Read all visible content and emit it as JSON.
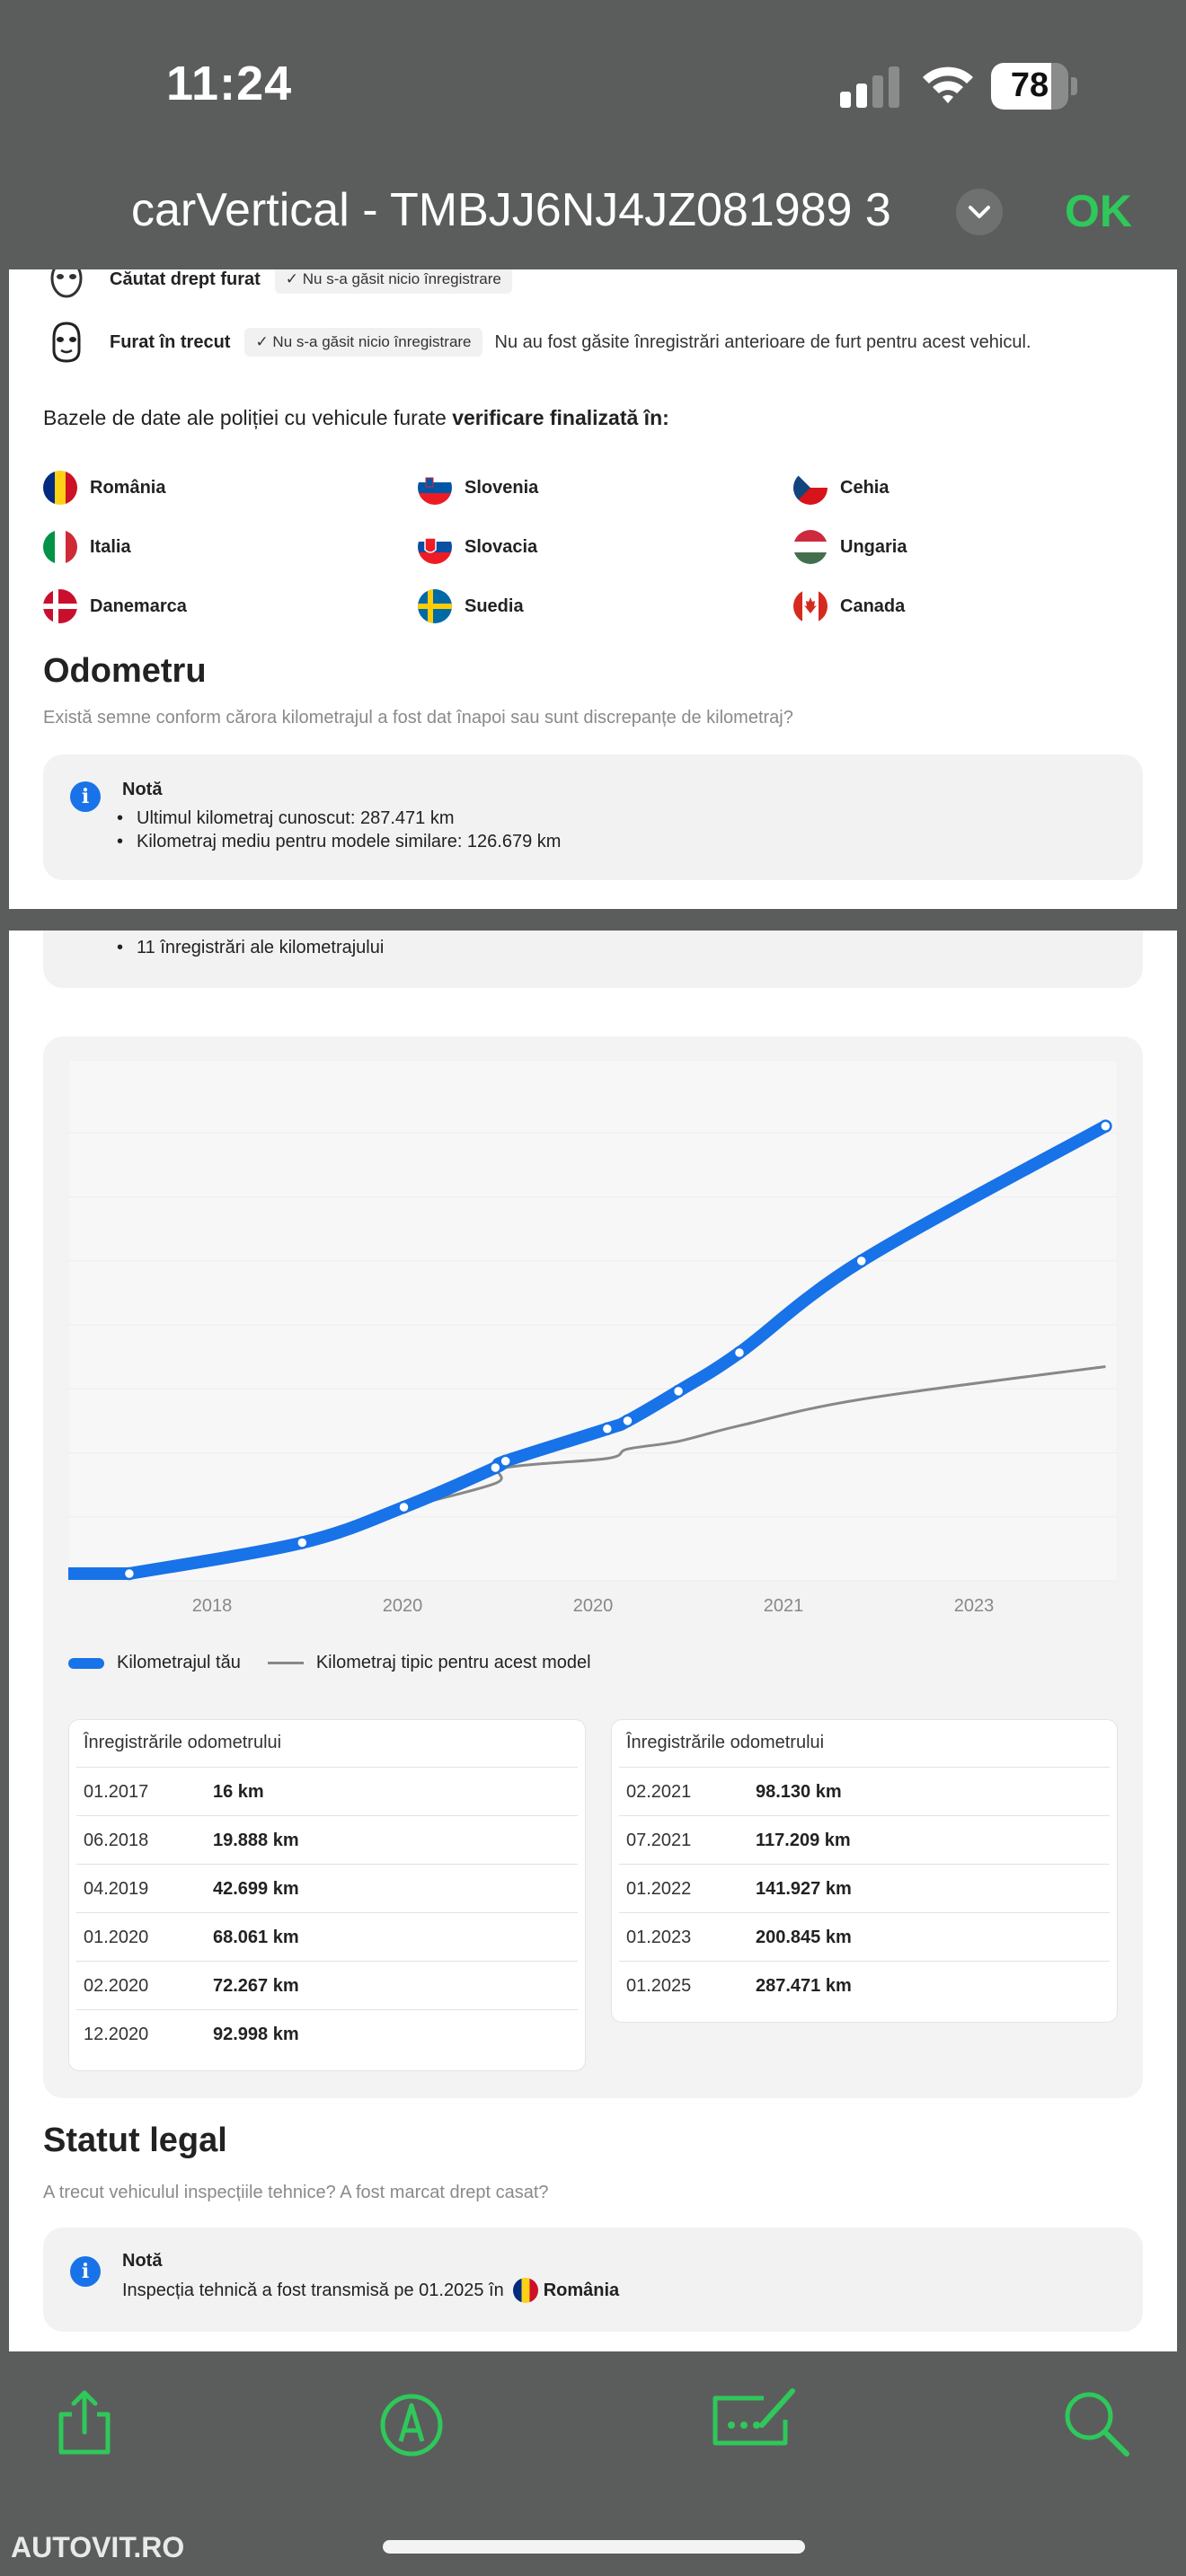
{
  "status_bar": {
    "time": "11:24",
    "battery": "78",
    "battery_level": 0.78
  },
  "header": {
    "title": "carVertical - TMBJJ6NJ4JZ081989 3",
    "ok_label": "OK"
  },
  "theft": {
    "row1_label": "Căutat drept furat",
    "row1_chip": "Nu s-a găsit nicio înregistrare",
    "row2_label": "Furat în trecut",
    "row2_chip": "Nu s-a găsit nicio înregistrare",
    "row2_desc": "Nu au fost găsite înregistrări anterioare de furt pentru acest vehicul."
  },
  "police_db": {
    "text": "Bazele de date ale poliției cu vehicule furate ",
    "bold": "verificare finalizată în:",
    "countries": [
      "România",
      "Slovenia",
      "Cehia",
      "Italia",
      "Slovacia",
      "Ungaria",
      "Danemarca",
      "Suedia",
      "Canada"
    ]
  },
  "odometer": {
    "title": "Odometru",
    "subtitle": "Există semne conform cărora kilometrajul a fost dat înapoi sau sunt discrepanțe de kilometraj?",
    "note_title": "Notă",
    "note_items": [
      "Ultimul kilometraj cunoscut: 287.471 km",
      "Kilometraj mediu pentru modele similare: 126.679 km",
      "11 înregistrări ale kilometrajului"
    ],
    "legend_yours": "Kilometrajul tău",
    "legend_typical": "Kilometraj tipic pentru acest model",
    "table_head": "Înregistrările odometrului",
    "records_left": [
      {
        "date": "01.2017",
        "km": "16 km"
      },
      {
        "date": "06.2018",
        "km": "19.888 km"
      },
      {
        "date": "04.2019",
        "km": "42.699 km"
      },
      {
        "date": "01.2020",
        "km": "68.061 km"
      },
      {
        "date": "02.2020",
        "km": "72.267 km"
      },
      {
        "date": "12.2020",
        "km": "92.998 km"
      }
    ],
    "records_right": [
      {
        "date": "02.2021",
        "km": "98.130 km"
      },
      {
        "date": "07.2021",
        "km": "117.209 km"
      },
      {
        "date": "01.2022",
        "km": "141.927 km"
      },
      {
        "date": "01.2023",
        "km": "200.845 km"
      },
      {
        "date": "01.2025",
        "km": "287.471 km"
      }
    ]
  },
  "chart_data": {
    "type": "line",
    "x_tick_labels": [
      "2018",
      "2020",
      "2020",
      "2021",
      "2023"
    ],
    "x": [
      "01.2017",
      "06.2018",
      "04.2019",
      "01.2020",
      "02.2020",
      "12.2020",
      "02.2021",
      "07.2021",
      "01.2022",
      "01.2023",
      "01.2025"
    ],
    "series": [
      {
        "name": "Kilometrajul tău",
        "color": "#1872e8",
        "values": [
          16,
          19888,
          42699,
          68061,
          72267,
          92998,
          98130,
          117209,
          141927,
          200845,
          287471
        ]
      },
      {
        "name": "Kilometraj tipic pentru acest model",
        "color": "#888888",
        "values": [
          16,
          22000,
          42000,
          58000,
          68000,
          74000,
          80000,
          85000,
          95000,
          112000,
          133000
        ]
      }
    ],
    "grid": true
  },
  "legal": {
    "title": "Statut legal",
    "subtitle": "A trecut vehiculul inspecțiile tehnice? A fost marcat drept casat?",
    "note_title": "Notă",
    "note_text": "Inspecția tehnică a fost transmisă pe 01.2025 în",
    "country": "România"
  },
  "watermark": "AUTOVIT.RO"
}
